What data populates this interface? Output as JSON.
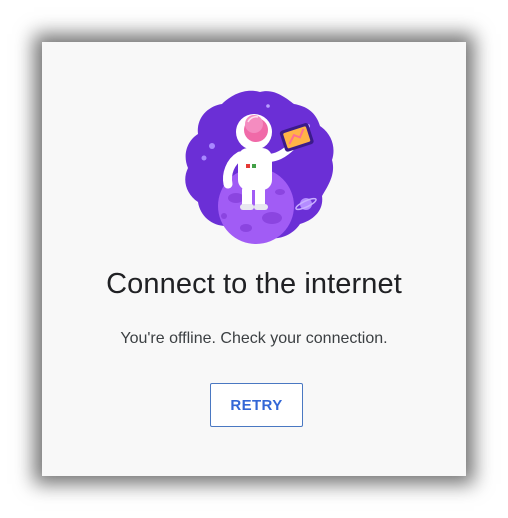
{
  "dialog": {
    "illustration_icon": "astronaut-on-planet-illustration",
    "title": "Connect to the internet",
    "message": "You're offline. Check your connection.",
    "retry_label": "RETRY"
  },
  "colors": {
    "background": "#f8f8f8",
    "title_text": "#202124",
    "body_text": "#3c4043",
    "accent_blue": "#3367d6",
    "illustration_purple": "#6b2fd6",
    "planet_violet": "#a15cf5"
  }
}
